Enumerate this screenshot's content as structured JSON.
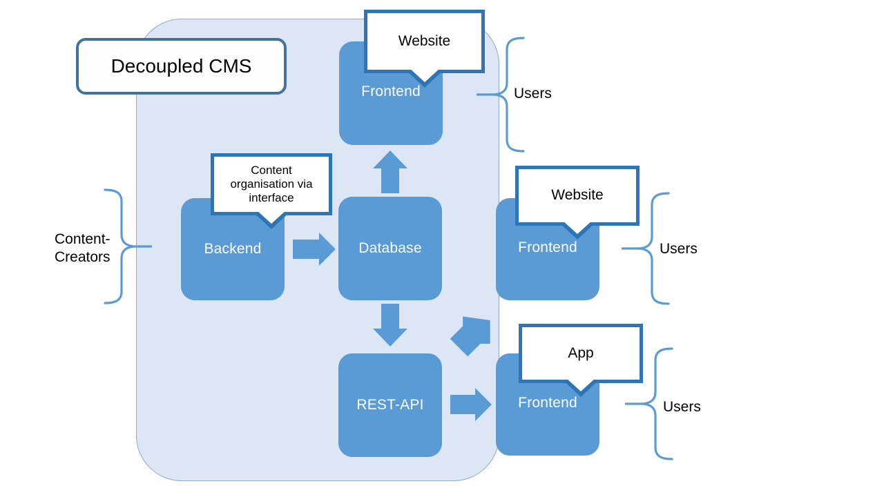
{
  "diagram": {
    "title": "Decoupled CMS",
    "colors": {
      "container_fill": "#dce6f5",
      "container_border": "#8ea9c9",
      "node_fill": "#5b9bd5",
      "node_text": "#ffffff",
      "callout_border": "#2e75b6",
      "callout_fill": "#ffffff",
      "title_border": "#41719c",
      "brace_stroke": "#5b9bd5",
      "text": "#000000"
    },
    "container": {
      "label": "Decoupled CMS"
    },
    "nodes": [
      {
        "id": "frontend-top",
        "label": "Frontend"
      },
      {
        "id": "backend",
        "label": "Backend"
      },
      {
        "id": "database",
        "label": "Database"
      },
      {
        "id": "rest-api",
        "label": "REST-API"
      },
      {
        "id": "frontend-mid",
        "label": "Frontend"
      },
      {
        "id": "frontend-bottom",
        "label": "Frontend"
      }
    ],
    "callouts": [
      {
        "id": "website-top",
        "text": "Website"
      },
      {
        "id": "content-org",
        "text": "Content organisation via interface"
      },
      {
        "id": "website-mid",
        "text": "Website"
      },
      {
        "id": "app",
        "text": "App"
      }
    ],
    "braces": [
      {
        "id": "content-creators",
        "label": "Content-\nCreators",
        "direction": "right"
      },
      {
        "id": "users-top",
        "label": "Users",
        "direction": "left"
      },
      {
        "id": "users-mid",
        "label": "Users",
        "direction": "left"
      },
      {
        "id": "users-bottom",
        "label": "Users",
        "direction": "left"
      }
    ],
    "arrows": [
      {
        "id": "backend-to-database",
        "direction": "right"
      },
      {
        "id": "database-to-frontend-top",
        "direction": "up"
      },
      {
        "id": "database-to-restapi",
        "direction": "down"
      },
      {
        "id": "restapi-to-frontend-mid",
        "direction": "up-right"
      },
      {
        "id": "restapi-to-frontend-bottom",
        "direction": "right"
      }
    ]
  }
}
